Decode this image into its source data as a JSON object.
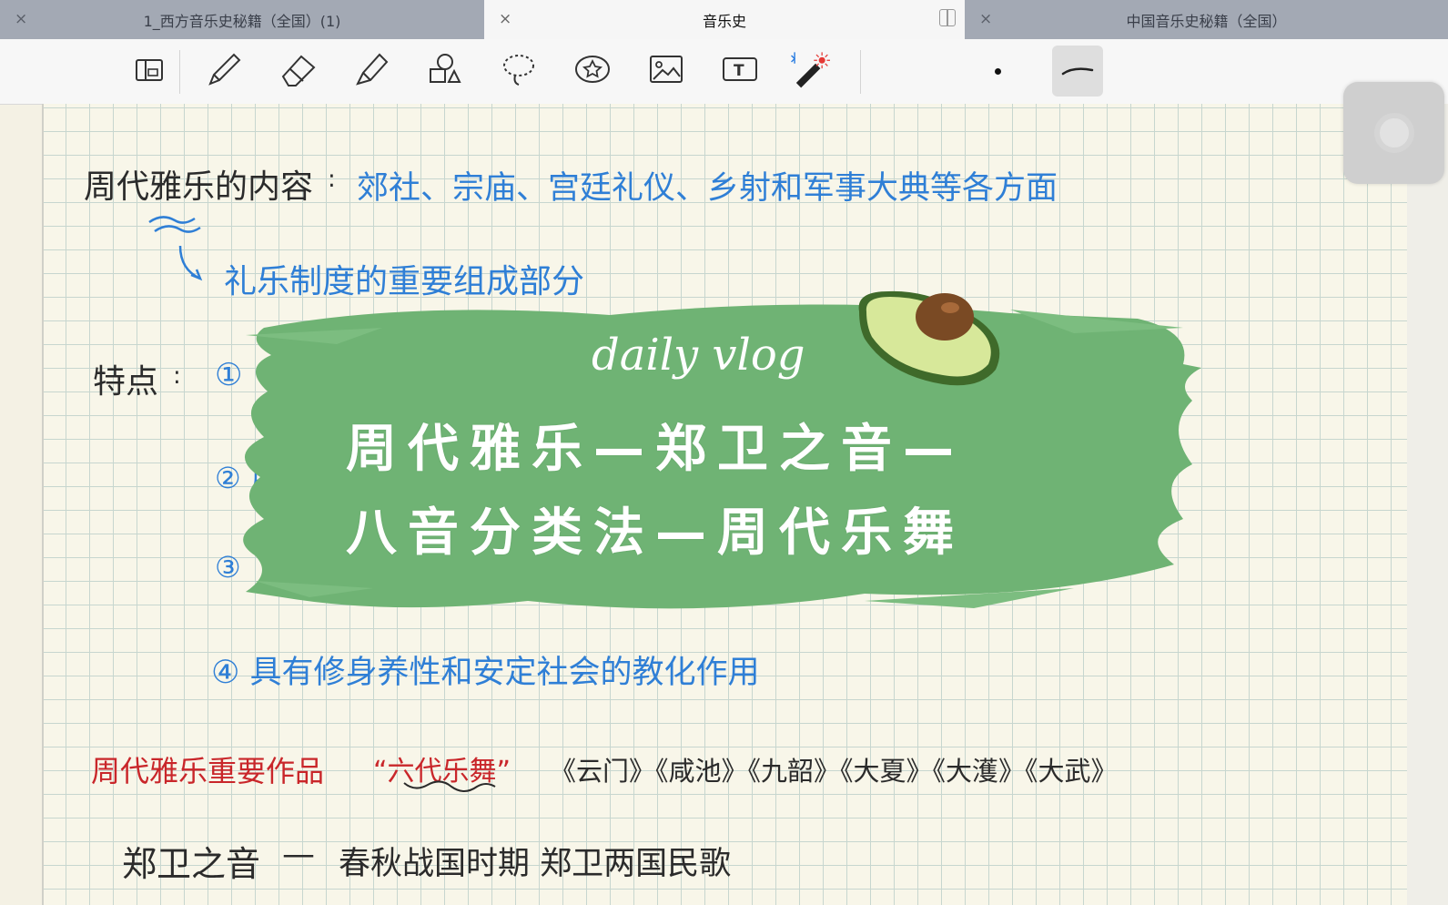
{
  "tabs": [
    {
      "label": "1_西方音乐史秘籍（全国）(1)",
      "close": "×"
    },
    {
      "label": "音乐史",
      "close": "×"
    },
    {
      "label": "中国音乐史秘籍（全国）",
      "close": "×"
    }
  ],
  "toolbar": {
    "icons": [
      "page-layout-icon",
      "pen-icon",
      "eraser-icon",
      "highlighter-icon",
      "shapes-icon",
      "lasso-icon",
      "sticker-icon",
      "image-icon",
      "text-box-icon",
      "laser-pointer-icon"
    ]
  },
  "notes": {
    "line1_label": "周代雅乐的内容",
    "line1_colon": ":",
    "line1_value": "郊社、宗庙、宫廷礼仪、乡射和军事大典等各方面",
    "line2": "礼乐制度的重要组成部分",
    "features_label": "特点",
    "features_colon": ":",
    "feature1": "①",
    "feature2": "② 用",
    "feature3": "③",
    "feature4": "④ 具有修身养性和安定社会的教化作用",
    "works_label": "周代雅乐重要作品",
    "works_highlight": "“六代乐舞”",
    "works_list": "《云门》《咸池》《九韶》《大夏》《大濩》《大武》",
    "zhengwei_label": "郑卫之音",
    "zhengwei_dash": "—",
    "zhengwei_value": "春秋战国时期 郑卫两国民歌"
  },
  "banner": {
    "subtitle": "daily vlog",
    "title_line1": "周代雅乐—郑卫之音—",
    "title_line2": "八音分类法—周代乐舞",
    "paint_color": "#6fb374",
    "icon": "avocado-icon"
  },
  "colors": {
    "ink_black": "#2b2b2b",
    "ink_blue": "#2f7fd6",
    "ink_red": "#c9262a"
  }
}
